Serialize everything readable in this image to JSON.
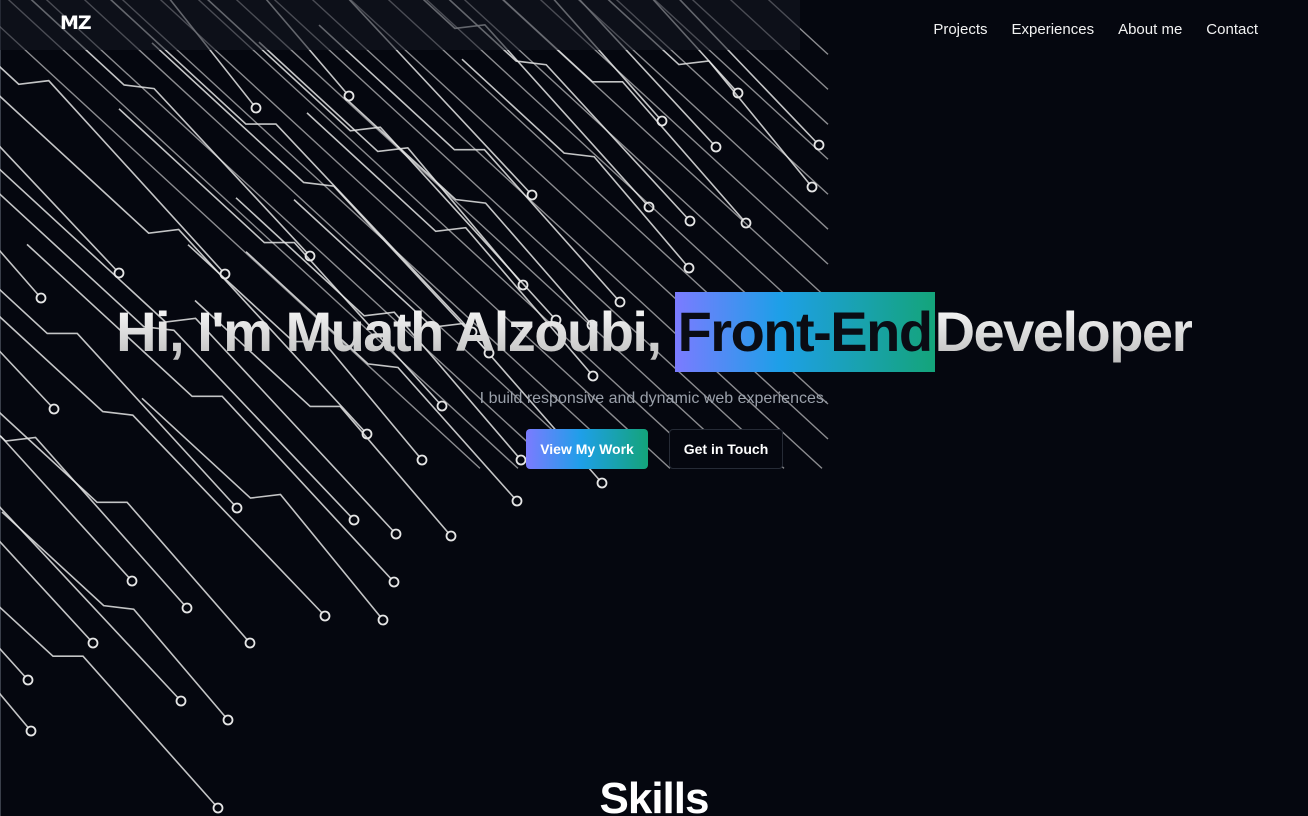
{
  "header": {
    "logo": "MZ",
    "nav": [
      "Projects",
      "Experiences",
      "About me",
      "Contact"
    ]
  },
  "hero": {
    "title_before": "Hi, I'm Muath Alzoubi,",
    "title_highlight": "Front-End",
    "title_after": "Developer",
    "subtitle": "I build responsive and dynamic web experiences.",
    "primary_button": "View My Work",
    "secondary_button": "Get in Touch"
  },
  "skills": {
    "title": "Skills"
  },
  "colors": {
    "background": "#05070f",
    "gradient_start": "#7b7bff",
    "gradient_mid": "#1e9fe8",
    "gradient_end": "#14a47a",
    "circuit_line": "#e6e6e6"
  }
}
